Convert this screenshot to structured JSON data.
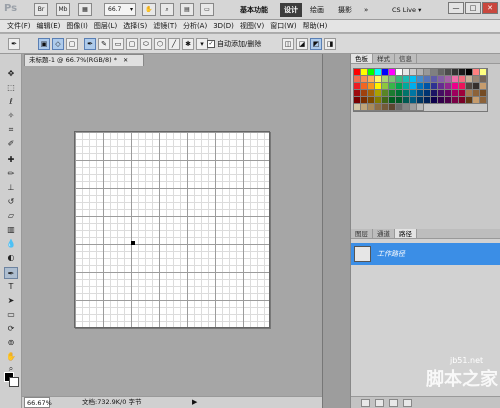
{
  "app": {
    "logo": "Ps",
    "zoom": "66.7",
    "workspaces": [
      "基本功能",
      "设计",
      "绘画",
      "摄影",
      "»"
    ],
    "cs_live": "CS Live ▾",
    "window_controls": [
      "—",
      "□",
      "✕"
    ]
  },
  "menu": [
    "文件(F)",
    "编辑(E)",
    "图像(I)",
    "图层(L)",
    "选择(S)",
    "滤镜(T)",
    "分析(A)",
    "3D(D)",
    "视图(V)",
    "窗口(W)",
    "帮助(H)"
  ],
  "options": {
    "auto_add_label": "自动添加/删除",
    "auto_add_checked": "✓"
  },
  "document": {
    "tab_title": "未标题-1 @ 66.7%(RGB/8) *",
    "tab_close": "✕",
    "status_zoom": "66.67%",
    "status_doc": "文档:732.9K/0 字节",
    "status_arrow": "▶"
  },
  "swatches_panel": {
    "tabs": [
      "色板",
      "样式",
      "信息"
    ],
    "colors": [
      "#ff0000",
      "#ffff00",
      "#00ff00",
      "#00ffff",
      "#0000ff",
      "#ff00ff",
      "#ffffff",
      "#e6e6e6",
      "#cccccc",
      "#b3b3b3",
      "#999999",
      "#808080",
      "#666666",
      "#4d4d4d",
      "#333333",
      "#1a1a1a",
      "#000000",
      "#ff8080",
      "#ffff80",
      "#f26c4f",
      "#f68e55",
      "#fbaf5c",
      "#fff467",
      "#acd372",
      "#7cc576",
      "#3bb878",
      "#1abbb4",
      "#00bff3",
      "#438ccb",
      "#5574b9",
      "#605ca8",
      "#855fa8",
      "#a763a8",
      "#f06ea9",
      "#f26d7d",
      "#c7b299",
      "#998675",
      "#736357",
      "#ed1c24",
      "#f26522",
      "#f7941d",
      "#fff200",
      "#8dc63f",
      "#39b54a",
      "#00a651",
      "#00a99d",
      "#00aeef",
      "#0072bc",
      "#0054a6",
      "#2e3192",
      "#662d91",
      "#92278f",
      "#ec008c",
      "#ed145b",
      "#534741",
      "#362f2d",
      "#c69c6d",
      "#9e0b0f",
      "#a0410d",
      "#a36209",
      "#aba000",
      "#598527",
      "#1a7b30",
      "#007236",
      "#00746b",
      "#0076a3",
      "#004b80",
      "#003471",
      "#1b1464",
      "#440e62",
      "#630460",
      "#9e005d",
      "#9e0039",
      "#a67c52",
      "#8c6239",
      "#754c24",
      "#790000",
      "#7b2e00",
      "#7d4900",
      "#827b00",
      "#406618",
      "#005e20",
      "#005826",
      "#005952",
      "#005b7f",
      "#003663",
      "#002157",
      "#0d004c",
      "#32004b",
      "#4b0049",
      "#7b0046",
      "#7a0026",
      "#603913",
      "#c69c6d",
      "#8c6239",
      "#d4c8a8",
      "#bfa57a",
      "#a88a5c",
      "#8d6e45",
      "#735a38",
      "#5c4630",
      "#6b6b6b",
      "#848484",
      "#9f9f9f",
      "#bababa"
    ]
  },
  "paths_panel": {
    "tabs": [
      "图层",
      "通道",
      "路径"
    ],
    "path_name": "工作路径"
  },
  "watermark": {
    "url": "jb51.net",
    "text": "脚本之家"
  }
}
